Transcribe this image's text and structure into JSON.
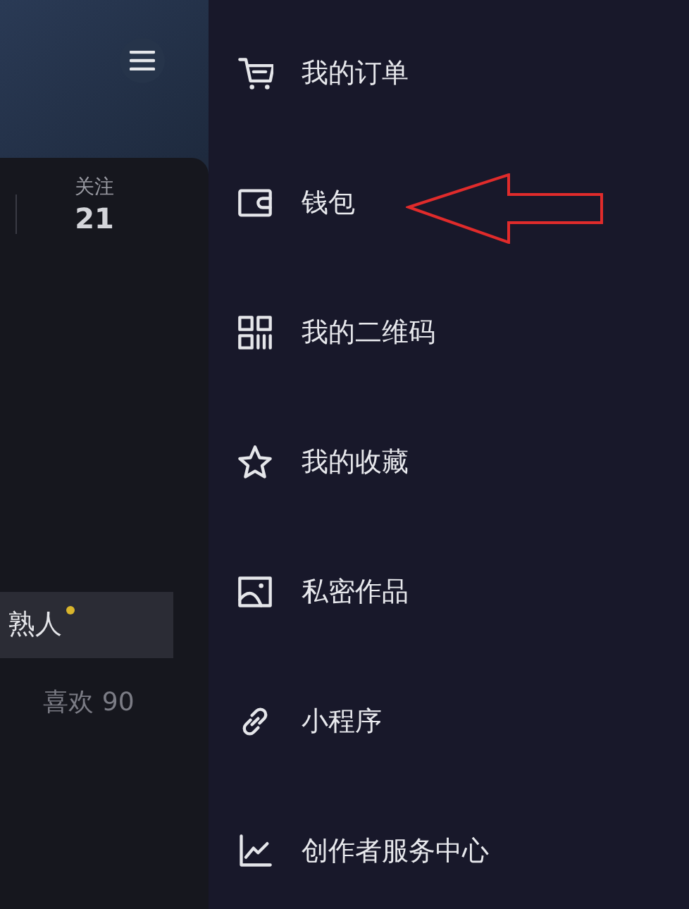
{
  "profile": {
    "stats": [
      {
        "label": "关注",
        "value": "21"
      }
    ],
    "tabs": [
      {
        "label": "熟人",
        "selected": true,
        "has_new": true
      }
    ],
    "likes": "喜欢 90"
  },
  "menu": {
    "items": [
      {
        "kind": "cart",
        "label": "我的订单"
      },
      {
        "kind": "wallet",
        "label": "钱包",
        "annotated": true
      },
      {
        "kind": "qr",
        "label": "我的二维码"
      },
      {
        "kind": "star",
        "label": "我的收藏"
      },
      {
        "kind": "image",
        "label": "私密作品"
      },
      {
        "kind": "link",
        "label": "小程序"
      },
      {
        "kind": "chart",
        "label": "创作者服务中心"
      }
    ]
  }
}
